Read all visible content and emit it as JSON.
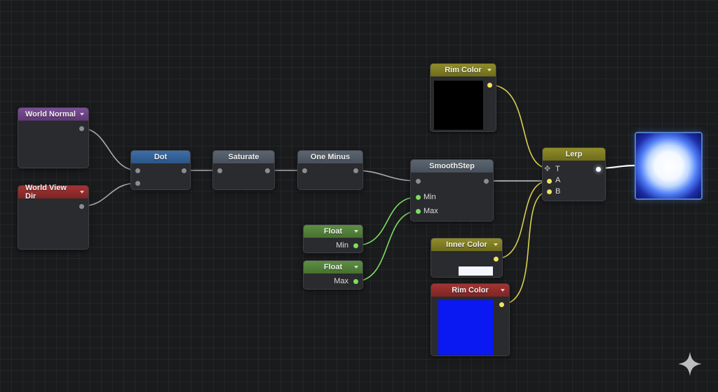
{
  "nodes": {
    "world_normal": {
      "title": "World Normal"
    },
    "world_view_dir": {
      "title": "World View Dir"
    },
    "dot": {
      "title": "Dot"
    },
    "saturate": {
      "title": "Saturate"
    },
    "one_minus": {
      "title": "One Minus"
    },
    "smoothstep": {
      "title": "SmoothStep",
      "pins": {
        "min": "Min",
        "max": "Max"
      }
    },
    "float_min": {
      "title": "Float",
      "output": "Min"
    },
    "float_max": {
      "title": "Float",
      "output": "Max"
    },
    "rim_color_top": {
      "title": "Rim Color",
      "swatch_color": "#000000"
    },
    "inner_color": {
      "title": "Inner Color",
      "swatch_color": "#f4f7ff"
    },
    "rim_color_bottom": {
      "title": "Rim Color",
      "swatch_color": "#0a18f2"
    },
    "lerp": {
      "title": "Lerp",
      "pins": {
        "t": "T",
        "a": "A",
        "b": "B"
      }
    }
  },
  "colors": {
    "wire_gray": "#a8abaf",
    "wire_green": "#7be05e",
    "wire_yellow": "#d9cf4e",
    "wire_white": "#ffffff"
  },
  "icons": {
    "preview": "rim-glow-preview",
    "watermark": "sparkle-icon"
  }
}
